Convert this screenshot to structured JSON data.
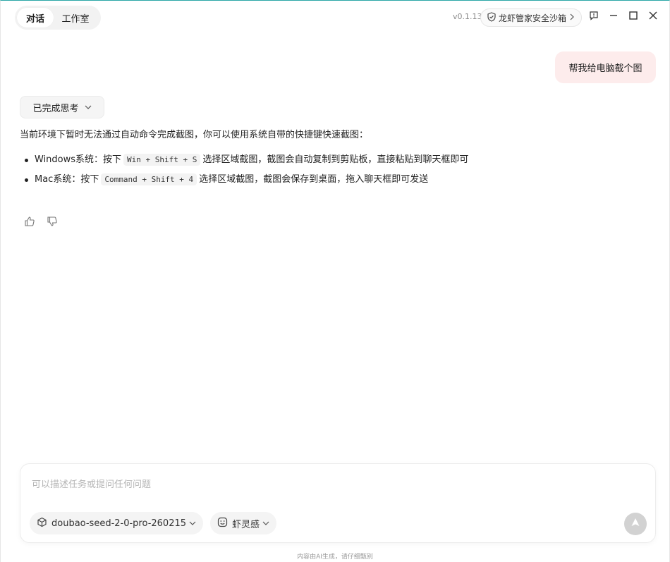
{
  "header": {
    "tabs": [
      {
        "label": "对话",
        "active": true
      },
      {
        "label": "工作室",
        "active": false
      }
    ],
    "version": "v0.1.13",
    "sandbox_label": "龙虾管家安全沙箱"
  },
  "conversation": {
    "user_message": "帮我给电脑截个图",
    "thinking_label": "已完成思考",
    "answer": {
      "intro": "当前环境下暂时无法通过自动命令完成截图，你可以使用系统自带的快捷键快速截图：",
      "items": [
        {
          "prefix": "Windows系统：按下",
          "shortcut": "Win + Shift + S",
          "suffix": "选择区域截图，截图会自动复制到剪贴板，直接粘贴到聊天框即可"
        },
        {
          "prefix": "Mac系统：按下",
          "shortcut": "Command + Shift + 4",
          "suffix": "选择区域截图，截图会保存到桌面，拖入聊天框即可发送"
        }
      ]
    }
  },
  "composer": {
    "placeholder": "可以描述任务或提问任何问题",
    "value": "",
    "model_label": "doubao-seed-2-0-pro-260215",
    "skill_label": "虾灵感"
  },
  "footer": {
    "disclaimer": "内容由AI生成，请仔细甄别"
  },
  "colors": {
    "accent_border": "#2aa7a7",
    "user_bubble": "#fdecec",
    "send_disabled": "#d2d2d2"
  }
}
